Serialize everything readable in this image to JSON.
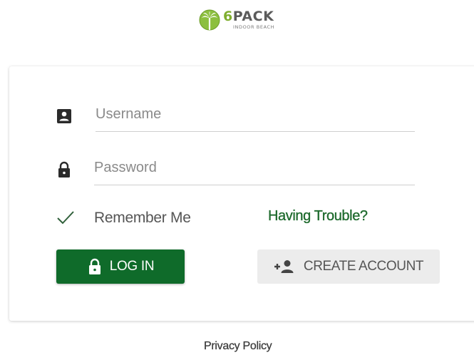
{
  "logo": {
    "brand_prefix": "6",
    "brand_name": "PACK",
    "subtitle": "INDOOR BEACH",
    "icon": "palm-tree-logo-icon"
  },
  "form": {
    "username": {
      "placeholder": "Username",
      "value": "",
      "icon": "user-badge-icon"
    },
    "password": {
      "placeholder": "Password",
      "value": "",
      "icon": "lock-icon"
    },
    "remember_me": {
      "label": "Remember Me",
      "checked": true,
      "icon": "checkmark-icon"
    },
    "trouble_link": "Having Trouble?",
    "login_button": {
      "label": "LOG IN",
      "icon": "lock-icon"
    },
    "create_account_button": {
      "label": "CREATE ACCOUNT",
      "icon": "add-person-icon"
    }
  },
  "footer": {
    "privacy_link": "Privacy Policy"
  },
  "colors": {
    "brand_green": "#0f6b2a",
    "link_green": "#1f6b2e",
    "logo_lime": "#7fae2e",
    "secondary_button_bg": "#ececec"
  }
}
